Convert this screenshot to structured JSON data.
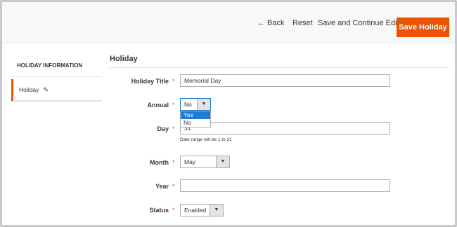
{
  "header": {
    "back_label": "Back",
    "reset_label": "Reset",
    "save_continue_label": "Save and Continue Edit",
    "save_label": "Save Holiday"
  },
  "sidebar": {
    "title": "HOLIDAY INFORMATION",
    "items": [
      {
        "label": "Holiday"
      }
    ]
  },
  "form": {
    "section_title": "Holiday",
    "holiday_title": {
      "label": "Holiday Title",
      "value": "Memorial Day"
    },
    "annual": {
      "label": "Annual",
      "value": "No",
      "options": [
        "Yes",
        "No"
      ],
      "highlighted_option": "Yes"
    },
    "day": {
      "label": "Day",
      "value": "31",
      "note": "Date range will be 1 to 31"
    },
    "month": {
      "label": "Month",
      "value": "May"
    },
    "year": {
      "label": "Year",
      "value": ""
    },
    "status": {
      "label": "Status",
      "value": "Enabled"
    }
  },
  "colors": {
    "accent": "#eb5202",
    "highlight": "#1e7bd6",
    "text": "#41362f"
  }
}
